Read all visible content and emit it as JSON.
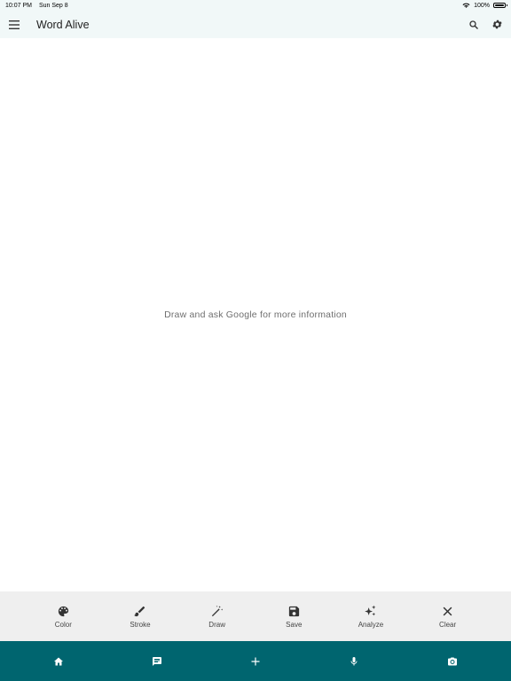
{
  "status_bar": {
    "time": "10:07 PM",
    "date": "Sun Sep 8",
    "battery": "100%",
    "battery_level": 1.0
  },
  "app_bar": {
    "title": "Word Alive",
    "icons": [
      "menu-icon",
      "search-icon",
      "gear-icon"
    ]
  },
  "canvas": {
    "hint": "Draw and ask Google for more information"
  },
  "toolbar": {
    "items": [
      {
        "label": "Color",
        "icon": "palette-icon"
      },
      {
        "label": "Stroke",
        "icon": "brush-icon"
      },
      {
        "label": "Draw",
        "icon": "magic-wand-icon"
      },
      {
        "label": "Save",
        "icon": "floppy-icon"
      },
      {
        "label": "Analyze",
        "icon": "sparkle-icon"
      },
      {
        "label": "Clear",
        "icon": "close-icon"
      }
    ]
  },
  "bottom_nav": {
    "icons": [
      "home-icon",
      "chat-icon",
      "plus-icon",
      "microphone-icon",
      "camera-icon"
    ],
    "background": "#00656f"
  },
  "colors": {
    "app_bar_bg": "#f1f8f8",
    "toolbar_bg": "#efefef",
    "accent": "#00656f"
  }
}
